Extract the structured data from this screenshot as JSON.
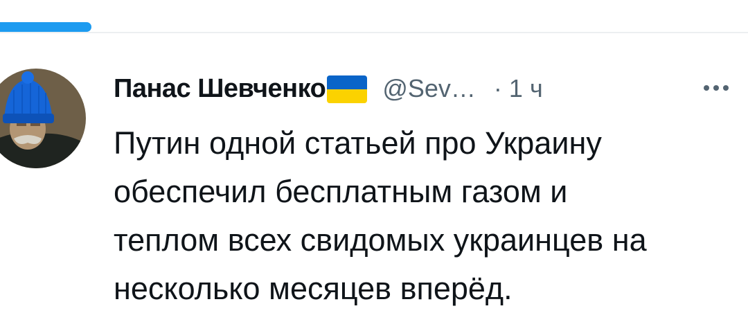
{
  "tweet": {
    "author": {
      "display_name": "Панас Шевченко",
      "flag_emoji": "ukraine-flag",
      "handle": "@Sev…"
    },
    "separator": "·",
    "timestamp": "1 ч",
    "more_icon": "more-horizontal-icon",
    "text_lines": [
      "Путин одной статьей про Украину",
      "обеспечил бесплатным газом и",
      "теплом всех свидомых украинцев на",
      "несколько месяцев вперёд."
    ]
  },
  "colors": {
    "accent": "#1d9bf0",
    "text_primary": "#0f1419",
    "text_secondary": "#536471",
    "divider": "#eceff1",
    "flag_blue": "#0a64c8",
    "flag_yellow": "#fbd200"
  }
}
